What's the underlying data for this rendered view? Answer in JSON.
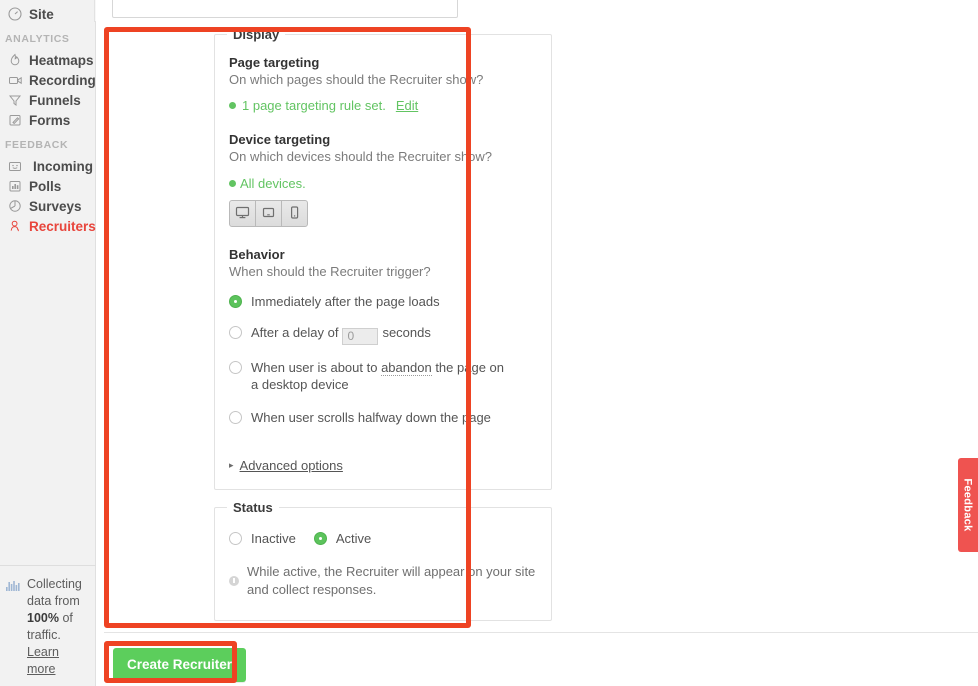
{
  "sidebar": {
    "collapse_icon": "chevron-left-icon",
    "top_item": {
      "label": "Site",
      "icon": "gauge-icon"
    },
    "groups": [
      {
        "title": "ANALYTICS",
        "items": [
          {
            "label": "Heatmaps",
            "icon": "flame-icon",
            "active": false
          },
          {
            "label": "Recordings",
            "icon": "video-icon",
            "active": false
          },
          {
            "label": "Funnels",
            "icon": "funnel-icon",
            "active": false
          },
          {
            "label": "Forms",
            "icon": "form-edit-icon",
            "active": false
          }
        ]
      },
      {
        "title": "FEEDBACK",
        "items": [
          {
            "label": "Incoming",
            "icon": "smiley-icon",
            "active": false
          },
          {
            "label": "Polls",
            "icon": "bar-chart-icon",
            "active": false
          },
          {
            "label": "Surveys",
            "icon": "pie-chart-icon",
            "active": false
          },
          {
            "label": "Recruiters",
            "icon": "person-icon",
            "active": true
          }
        ]
      }
    ],
    "footer": {
      "icon": "traffic-bars-icon",
      "text_before": "Collecting data from ",
      "percent": "100%",
      "text_after": " of traffic.",
      "link": "Learn more"
    }
  },
  "top_field": {
    "value": "",
    "placeholder": ""
  },
  "display": {
    "legend": "Display",
    "page_targeting": {
      "title": "Page targeting",
      "description": "On which pages should the Recruiter show?",
      "status": "1 page targeting rule set.",
      "edit_link": "Edit"
    },
    "device_targeting": {
      "title": "Device targeting",
      "description": "On which devices should the Recruiter show?",
      "status": "All devices.",
      "devices": [
        {
          "name": "desktop-device-button",
          "icon": "monitor-icon"
        },
        {
          "name": "tablet-device-button",
          "icon": "tablet-icon"
        },
        {
          "name": "mobile-device-button",
          "icon": "phone-icon"
        }
      ]
    },
    "behavior": {
      "title": "Behavior",
      "description": "When should the Recruiter trigger?",
      "options": [
        {
          "label": "Immediately after the page loads",
          "checked": true
        },
        {
          "label_before": "After a delay of",
          "delay_value": "0",
          "label_after": "seconds",
          "checked": false
        },
        {
          "label_part1": "When user is about to ",
          "tooltip_word": "abandon",
          "label_part2": " the page on a desktop device",
          "checked": false
        },
        {
          "label": "When user scrolls halfway down the page",
          "checked": false
        }
      ],
      "advanced_link": "Advanced options",
      "advanced_chevron": "chevron-right-icon"
    }
  },
  "status": {
    "legend": "Status",
    "options": [
      {
        "label": "Inactive",
        "checked": false
      },
      {
        "label": "Active",
        "checked": true
      }
    ],
    "info_icon": "info-icon",
    "info_text": "While active, the Recruiter will appear on your site and collect responses."
  },
  "footer": {
    "create_button": "Create Recruiter"
  },
  "feedback_tab": {
    "label": "Feedback",
    "icon": "speech-bubble-icon"
  },
  "colors": {
    "accent_red": "#e8453c",
    "annotation_red": "#ee4323",
    "green": "#62c462",
    "button_green": "#5cce5c",
    "sidebar_bg": "#f2f2f2",
    "text_dark": "#333333",
    "text_muted": "#7b7b7b"
  }
}
